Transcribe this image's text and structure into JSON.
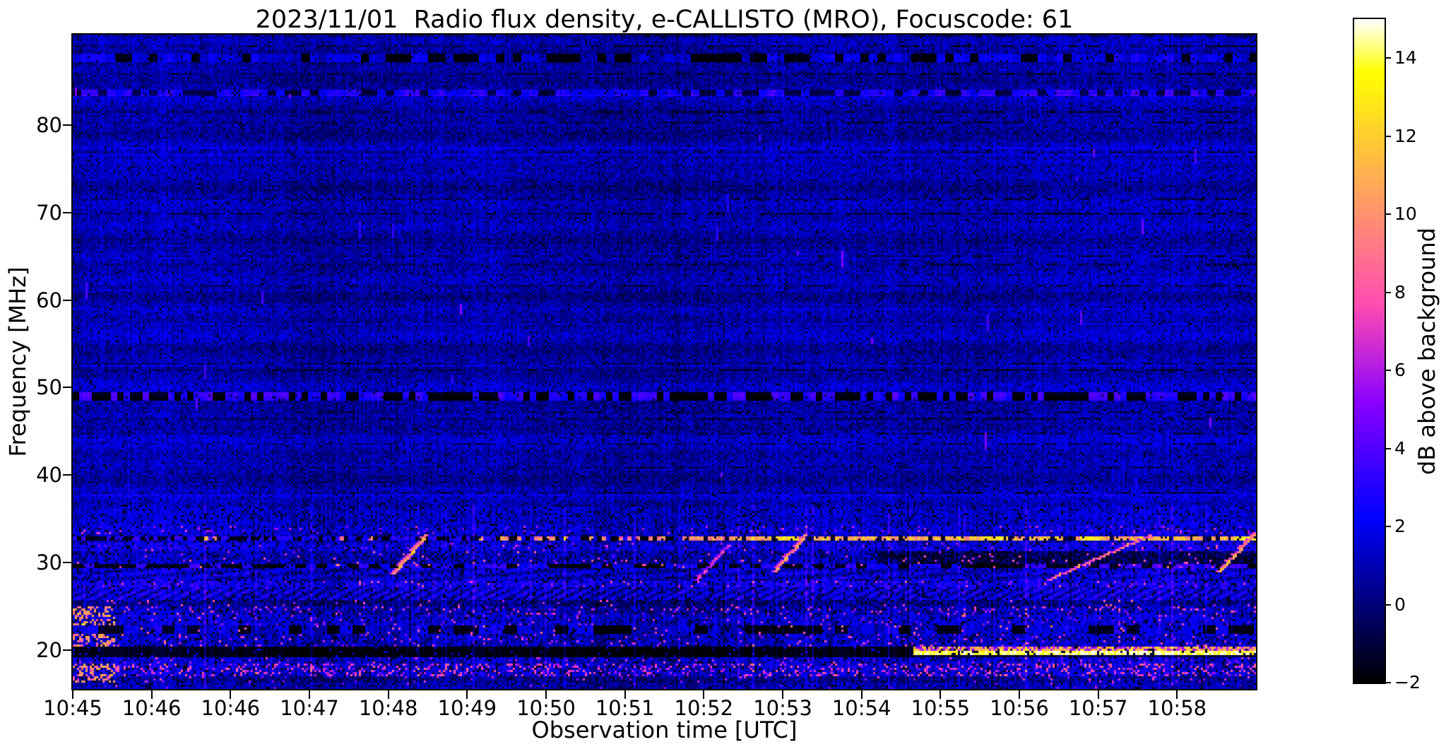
{
  "title": "2023/11/01  Radio flux density, e-CALLISTO (MRO), Focuscode: 61",
  "x_axis": {
    "label": "Observation time [UTC]",
    "tick_labels": [
      "10:45",
      "10:46",
      "10:46",
      "10:47",
      "10:48",
      "10:49",
      "10:50",
      "10:51",
      "10:52",
      "10:53",
      "10:54",
      "10:55",
      "10:56",
      "10:57",
      "10:58"
    ]
  },
  "y_axis": {
    "label": "Frequency [MHz]",
    "tick_values": [
      20,
      30,
      40,
      50,
      60,
      70,
      80
    ],
    "tick_labels": [
      "20",
      "30",
      "40",
      "50",
      "60",
      "70",
      "80"
    ]
  },
  "colorbar": {
    "label": "dB above background",
    "tick_values": [
      -2,
      0,
      2,
      4,
      6,
      8,
      10,
      12,
      14
    ],
    "tick_labels": [
      "−2",
      "0",
      "2",
      "4",
      "6",
      "8",
      "10",
      "12",
      "14"
    ],
    "vmin": -2,
    "vmax": 15,
    "colormap": "gnuplot2",
    "color_anchors": {
      "background_blue": "#0000a8",
      "bright_blue": "#0000f0",
      "magenta": "#e800c8",
      "orange": "#ff9c50",
      "yellow": "#ffff00",
      "white_top": "#ffffff",
      "black_bottom": "#000000"
    }
  },
  "chart_data": {
    "type": "heatmap",
    "title": "2023/11/01  Radio flux density, e-CALLISTO (MRO), Focuscode: 61",
    "xlabel": "Observation time [UTC]",
    "ylabel": "Frequency [MHz]",
    "zlabel": "dB above background",
    "x_tick_labels": [
      "10:45",
      "10:46",
      "10:46",
      "10:47",
      "10:48",
      "10:49",
      "10:50",
      "10:51",
      "10:52",
      "10:53",
      "10:54",
      "10:55",
      "10:56",
      "10:57",
      "10:58"
    ],
    "freq_range_mhz": [
      15.56,
      90.33
    ],
    "value_range_db": [
      -2,
      15
    ],
    "colormap": "gnuplot2",
    "seed": 61,
    "grid": {
      "cols": 559,
      "rows": 309
    },
    "bands": [
      {
        "f": [
          88.1,
          90.4
        ],
        "style": "noise",
        "base": 0.6,
        "noise": 0.9
      },
      {
        "f": [
          87.2,
          88.1
        ],
        "style": "dashes",
        "base": -0.2,
        "noise": 0.8,
        "p_black": 0.4,
        "black": -1.6,
        "bright": 2.0,
        "run": 4
      },
      {
        "f": [
          84.0,
          87.2
        ],
        "style": "noise",
        "base": 0.7,
        "noise": 0.9
      },
      {
        "f": [
          83.2,
          84.0
        ],
        "style": "dashes",
        "base": -0.2,
        "noise": 0.8,
        "p_black": 0.38,
        "black": -1.5,
        "bright": 2.0,
        "run": 4
      },
      {
        "f": [
          49.5,
          83.2
        ],
        "style": "noise",
        "base": 0.8,
        "noise": 0.9
      },
      {
        "f": [
          48.5,
          49.5
        ],
        "style": "dashes",
        "base": 0.0,
        "noise": 0.5,
        "p_black": 0.52,
        "black": -2.0,
        "bright": 3.2,
        "run": 3
      },
      {
        "f": [
          36.3,
          48.5
        ],
        "style": "noise",
        "base": 0.9,
        "noise": 0.95
      },
      {
        "f": [
          34.3,
          36.3
        ],
        "style": "noise",
        "base": 1.35,
        "noise": 1.0
      },
      {
        "f": [
          33.3,
          34.3
        ],
        "style": "noise",
        "base": 1.6,
        "noise": 1.2,
        "p_speckle": 0.05,
        "speckle": 5.5
      },
      {
        "f": [
          32.3,
          33.3
        ],
        "style": "rfi33"
      },
      {
        "f": [
          31.3,
          32.3
        ],
        "style": "noise",
        "base": 1.9,
        "noise": 1.3,
        "p_speckle": 0.03,
        "speckle": 6.0
      },
      {
        "f": [
          29.8,
          31.3
        ],
        "style": "noise",
        "base": 1.0,
        "noise": 1.3,
        "p_speckle": 0.025,
        "speckle": 7.0,
        "t_dark": 0.68,
        "base2": -0.7
      },
      {
        "f": [
          29.3,
          29.8
        ],
        "style": "dashes",
        "base": 0.0,
        "noise": 0.7,
        "p_black": 0.45,
        "black": -1.8,
        "bright": 2.8,
        "run": 5,
        "p_speckle": 0.02,
        "speckle": 8.0
      },
      {
        "f": [
          28.0,
          29.3
        ],
        "style": "wave",
        "base": 1.4,
        "noise": 1.1,
        "amp": 0.9
      },
      {
        "f": [
          27.1,
          28.0
        ],
        "style": "noise",
        "base": 2.2,
        "noise": 1.4,
        "p_speckle": 0.05,
        "speckle": 6.5
      },
      {
        "f": [
          25.8,
          27.1
        ],
        "style": "hatch",
        "base": 1.6,
        "noise": 1.0,
        "amp": 1.3
      },
      {
        "f": [
          25.0,
          25.8
        ],
        "style": "noise",
        "base": 0.3,
        "noise": 1.2,
        "p_speckle": 0.03,
        "speckle": 7.0
      },
      {
        "f": [
          24.0,
          25.0
        ],
        "style": "noise",
        "base": 1.0,
        "noise": 1.3,
        "p_speckle": 0.1,
        "speckle": 6.5,
        "left_burst": true
      },
      {
        "f": [
          22.7,
          24.0
        ],
        "style": "noise",
        "base": 1.5,
        "noise": 1.2,
        "p_speckle": 0.04,
        "speckle": 6.0,
        "left_burst": true
      },
      {
        "f": [
          21.9,
          22.7
        ],
        "style": "dashes",
        "base": 0.0,
        "noise": 0.9,
        "p_black": 0.4,
        "black": -1.7,
        "bright": 1.8,
        "run": 6,
        "p_speckle": 0.02,
        "speckle": 8.0
      },
      {
        "f": [
          20.5,
          21.9
        ],
        "style": "noise",
        "base": 1.2,
        "noise": 1.3,
        "p_speckle": 0.05,
        "speckle": 6.5,
        "left_burst": true
      },
      {
        "f": [
          19.3,
          20.5
        ],
        "style": "flare20"
      },
      {
        "f": [
          18.4,
          19.3
        ],
        "style": "noise",
        "base": 1.4,
        "noise": 1.3,
        "p_speckle": 0.05,
        "speckle": 6.0
      },
      {
        "f": [
          17.0,
          18.4
        ],
        "style": "noise",
        "base": 1.6,
        "noise": 1.4,
        "p_speckle": 0.22,
        "speckle": 7.0,
        "left_burst": true
      },
      {
        "f": [
          16.3,
          17.0
        ],
        "style": "noise",
        "base": 0.4,
        "noise": 1.1,
        "p_speckle": 0.04,
        "speckle": 6.0,
        "left_burst": true
      },
      {
        "f": [
          15.5,
          16.3
        ],
        "style": "noise",
        "base": 0.9,
        "noise": 1.0,
        "p_speckle": 0.02,
        "speckle": 5.0
      }
    ],
    "rfi_line_33mhz": {
      "f_mhz": 32.8,
      "sparse_until_t": 0.36,
      "medium_until_t": 0.52,
      "dense_after_t": 0.52,
      "bright_blobs_t": [
        [
          0.595,
          0.612
        ],
        [
          0.768,
          0.787
        ],
        [
          0.851,
          0.869
        ],
        [
          0.982,
          1.0
        ]
      ]
    },
    "flare_line_20mhz": {
      "f_mhz": 20.0,
      "t_start": 0.71,
      "solid_db": 13.5,
      "speckle_db": 10.0
    },
    "bursts": [
      {
        "t": [
          0.272,
          0.297
        ],
        "f": [
          29.0,
          33.0
        ],
        "db": 11.0,
        "steps": 14
      },
      {
        "t": [
          0.528,
          0.552
        ],
        "f": [
          28.3,
          32.0
        ],
        "db": 7.5,
        "steps": 10
      },
      {
        "t": [
          0.594,
          0.617
        ],
        "f": [
          29.3,
          33.0
        ],
        "db": 10.5,
        "steps": 12
      },
      {
        "t": [
          0.826,
          0.908
        ],
        "f": [
          28.3,
          33.0
        ],
        "db": 10.0,
        "steps": 20
      },
      {
        "t": [
          0.97,
          1.0
        ],
        "f": [
          29.3,
          33.6
        ],
        "db": 11.0,
        "steps": 12
      }
    ],
    "rfi_spike_count": 30
  }
}
